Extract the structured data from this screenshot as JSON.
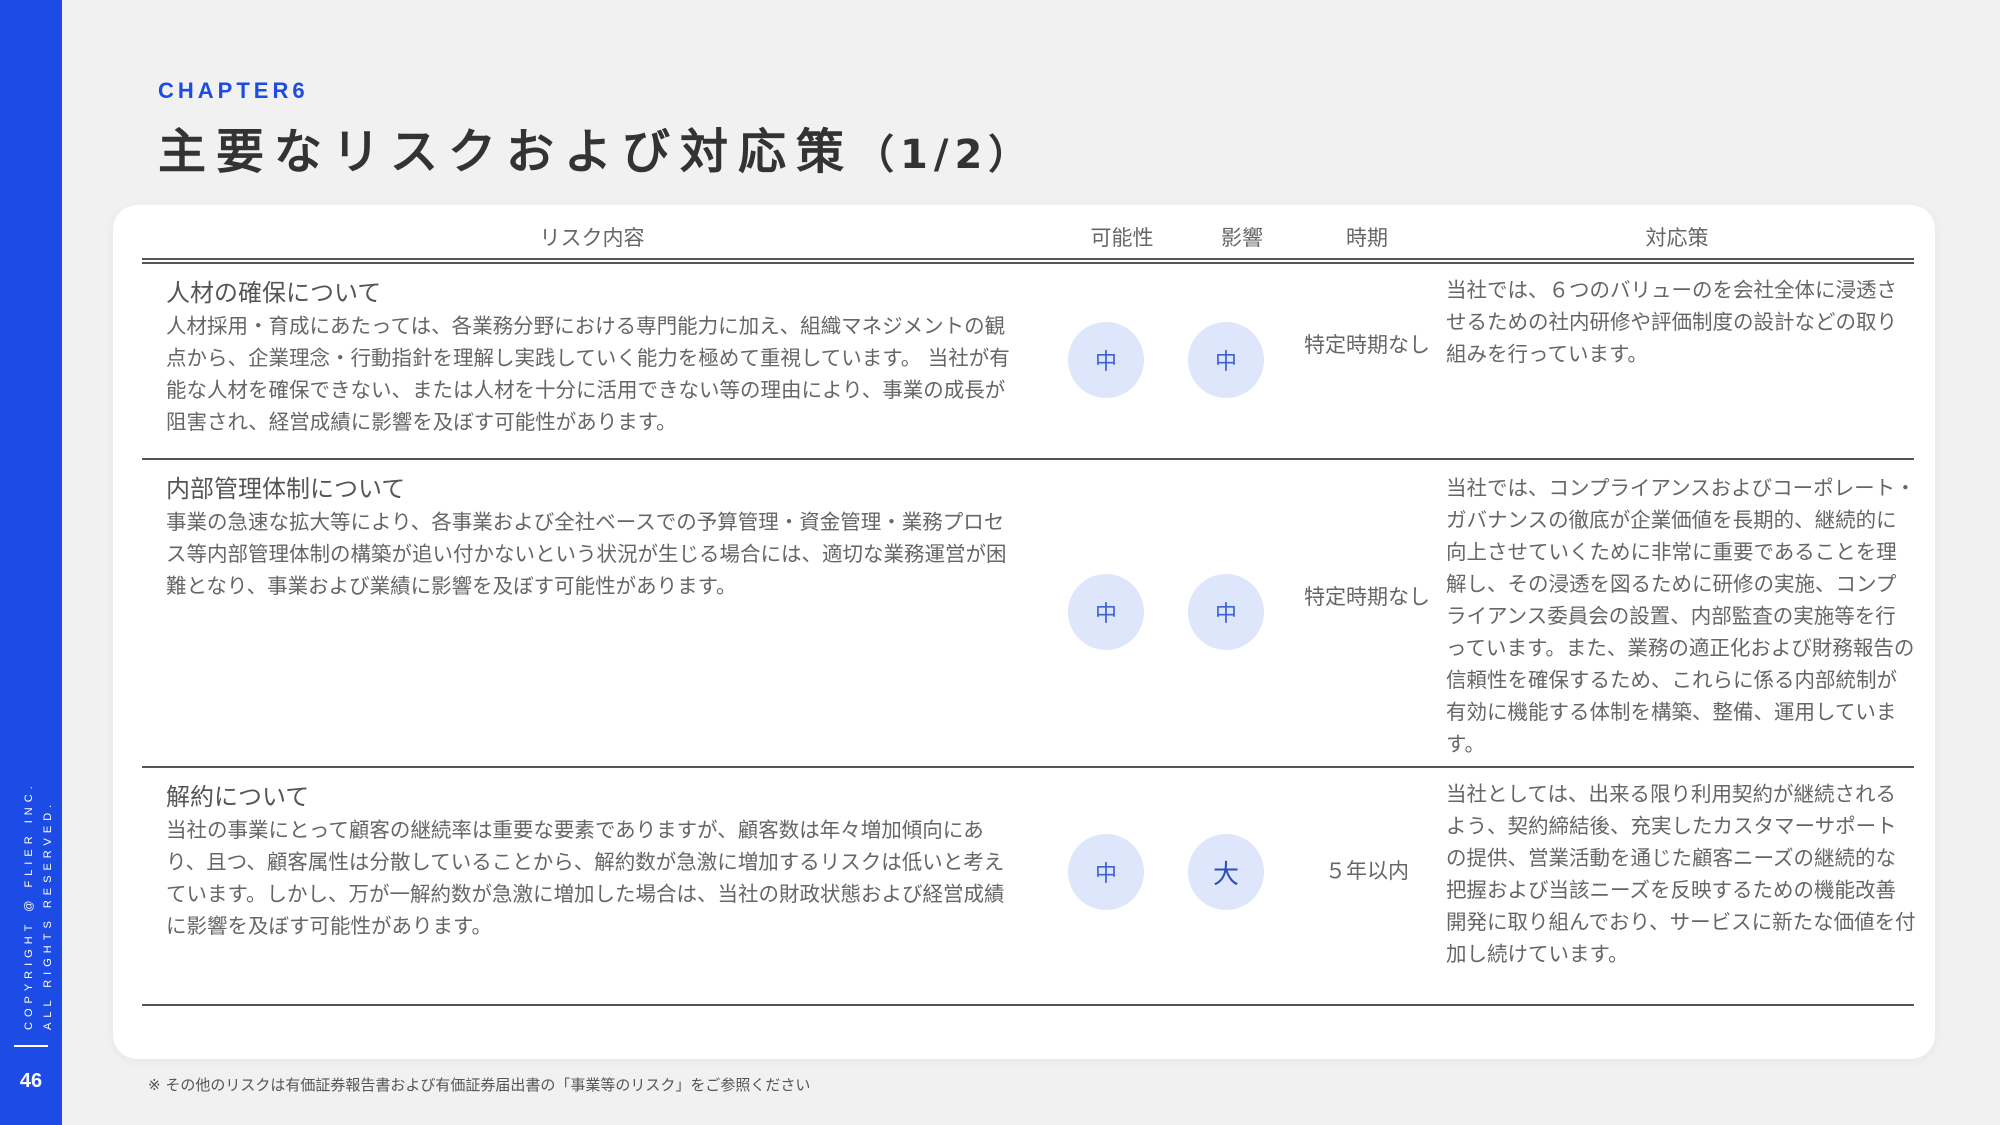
{
  "sidebar": {
    "copyright_line1": "COPYRIGHT @ FLIER INC.",
    "copyright_line2": "ALL RIGHTS RESERVED.",
    "page_number": "46"
  },
  "header": {
    "chapter": "CHAPTER6",
    "title": "主要なリスクおよび対応策",
    "title_suffix": "（1/2）"
  },
  "table": {
    "columns": {
      "risk": "リスク内容",
      "likelihood": "可能性",
      "impact": "影響",
      "timing": "時期",
      "measures": "対応策"
    },
    "rows": [
      {
        "title": "人材の確保について",
        "body": "人材採用・育成にあたっては、各業務分野における専門能力に加え、組織マネジメントの観点から、企業理念・行動指針を理解し実践していく能力を極めて重視しています。 当社が有能な人材を確保できない、または人材を十分に活用できない等の理由により、事業の成長が阻害され、経営成績に影響を及ぼす可能性があります。",
        "likelihood": "中",
        "impact": "中",
        "timing": "特定時期なし",
        "measures": "当社では、６つのバリューのを会社全体に浸透させるための社内研修や評価制度の設計などの取り組みを行っています。"
      },
      {
        "title": "内部管理体制について",
        "body": "事業の急速な拡大等により、各事業および全社ベースでの予算管理・資金管理・業務プロセス等内部管理体制の構築が追い付かないという状況が生じる場合には、適切な業務運営が困難となり、事業および業績に影響を及ぼす可能性があります。",
        "likelihood": "中",
        "impact": "中",
        "timing": "特定時期なし",
        "measures": "当社では、コンプライアンスおよびコーポレート・ガバナンスの徹底が企業価値を長期的、継続的に向上させていくために非常に重要であることを理解し、その浸透を図るために研修の実施、コンプライアンス委員会の設置、内部監査の実施等を行っています。また、業務の適正化および財務報告の信頼性を確保するため、これらに係る内部統制が有効に機能する体制を構築、整備、運用しています。"
      },
      {
        "title": "解約について",
        "body": "当社の事業にとって顧客の継続率は重要な要素でありますが、顧客数は年々増加傾向にあり、且つ、顧客属性は分散していることから、解約数が急激に増加するリスクは低いと考えています。しかし、万が一解約数が急激に増加した場合は、当社の財政状態および経営成績に影響を及ぼす可能性があります。",
        "likelihood": "中",
        "impact": "大",
        "timing": "５年以内",
        "measures": "当社としては、出来る限り利用契約が継続されるよう、契約締結後、充実したカスタマーサポートの提供、営業活動を通じた顧客ニーズの継続的な把握および当該ニーズを反映するための機能改善開発に取り組んでおり、サービスに新たな価値を付加し続けています。"
      }
    ]
  },
  "footnote": "※ その他のリスクは有価証券報告書および有価証券届出書の「事業等のリスク」をご参照ください",
  "colors": {
    "accent": "#1c4be6",
    "badge_bg": "#dde6fb",
    "badge_text": "#3d63d6",
    "background": "#f1f1f1"
  }
}
